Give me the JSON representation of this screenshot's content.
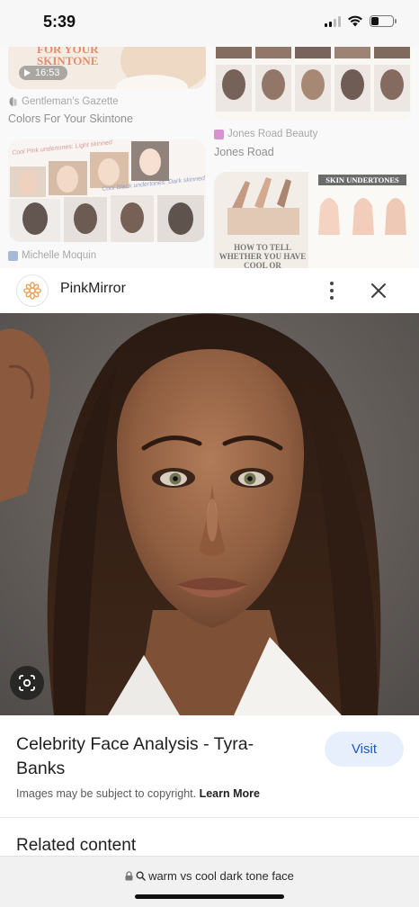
{
  "status_bar": {
    "time": "5:39",
    "battery_level": 0.35
  },
  "background_results": [
    {
      "overlay_text": "FOR YOUR SKINTONE",
      "duration": "16:53",
      "source": "Gentleman's Gazette",
      "title": "Colors For Your Skintone"
    },
    {
      "source": "Jones Road Beauty",
      "title": "Jones Road"
    },
    {
      "caption_a": "Cool Pink undertones: Light skinned",
      "caption_b": "Cool Black undertones: Dark skinned",
      "source": "Michelle Moquin",
      "title": ""
    },
    {
      "banner": "SKIN UNDERTONES",
      "caption": "HOW TO TELL WHETHER YOU HAVE COOL OR",
      "source": "",
      "title": ""
    }
  ],
  "header": {
    "site_name": "PinkMirror"
  },
  "result": {
    "title": "Celebrity Face Analysis - Tyra-Banks",
    "visit_label": "Visit",
    "copyright_text": "Images may be subject to copyright.",
    "learn_more": "Learn More",
    "related_heading": "Related content"
  },
  "url_bar": {
    "query": "warm vs cool dark tone face"
  },
  "icons": {
    "lock": "lock-icon",
    "search": "search-icon",
    "lens": "lens-icon",
    "more": "more-vert-icon",
    "close": "close-icon"
  },
  "colors": {
    "visit_bg": "#e8effc",
    "visit_text": "#1a57c9",
    "brand_logo": "#e8a35a"
  }
}
